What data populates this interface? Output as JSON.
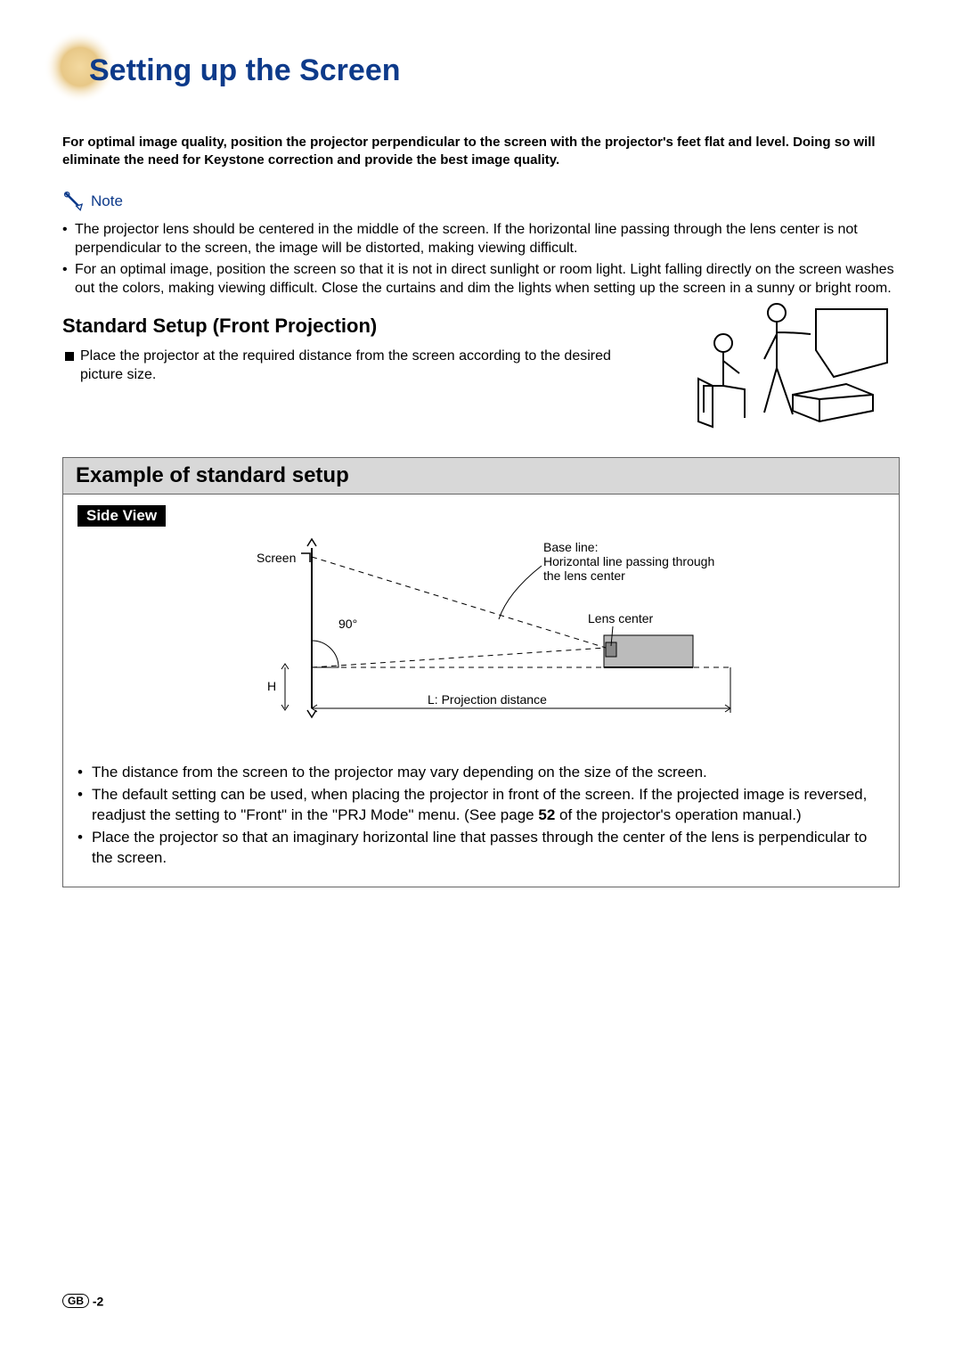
{
  "page_title": "Setting up the Screen",
  "intro_bold": "For optimal image quality, position the projector perpendicular to the screen with the projector's feet flat and level. Doing so will eliminate the need for Keystone correction and provide the best image quality.",
  "note_label": "Note",
  "note_bullets": [
    "The projector lens should be centered in the middle of the screen. If the horizontal line passing through the lens center is not perpendicular to the screen, the image will be distorted, making viewing difficult.",
    "For an optimal image, position the screen so that it is not in direct sunlight or room light. Light falling directly on the screen washes out the colors, making viewing difficult. Close the curtains and dim the lights when setting up the screen in a sunny or bright room."
  ],
  "standard_setup_heading": "Standard Setup (Front Projection)",
  "standard_setup_item": "Place the projector at the required distance from the screen according to the desired picture size.",
  "example_header": "Example of standard setup",
  "side_view_label": "Side View",
  "diagram_labels": {
    "screen": "Screen",
    "angle": "90°",
    "H": "H",
    "L": "L: Projection distance",
    "lens_center": "Lens center",
    "base_line1": "Base line:",
    "base_line2": "Horizontal line passing through",
    "base_line3": "the lens center"
  },
  "example_bullets": [
    {
      "pre": "The distance from the screen to the projector may vary depending on the size of the screen.",
      "bold": "",
      "post": ""
    },
    {
      "pre": "The default setting can be used, when placing the projector in front of the screen. If the projected image is reversed, readjust the setting to \"Front\" in the \"PRJ Mode\" menu. (See page ",
      "bold": "52",
      "post": " of the projector's operation manual.)"
    },
    {
      "pre": "Place the projector so that an imaginary horizontal line that passes through the center of the lens is perpendicular to the screen.",
      "bold": "",
      "post": ""
    }
  ],
  "footer_badge": "GB",
  "footer_page": "-2"
}
